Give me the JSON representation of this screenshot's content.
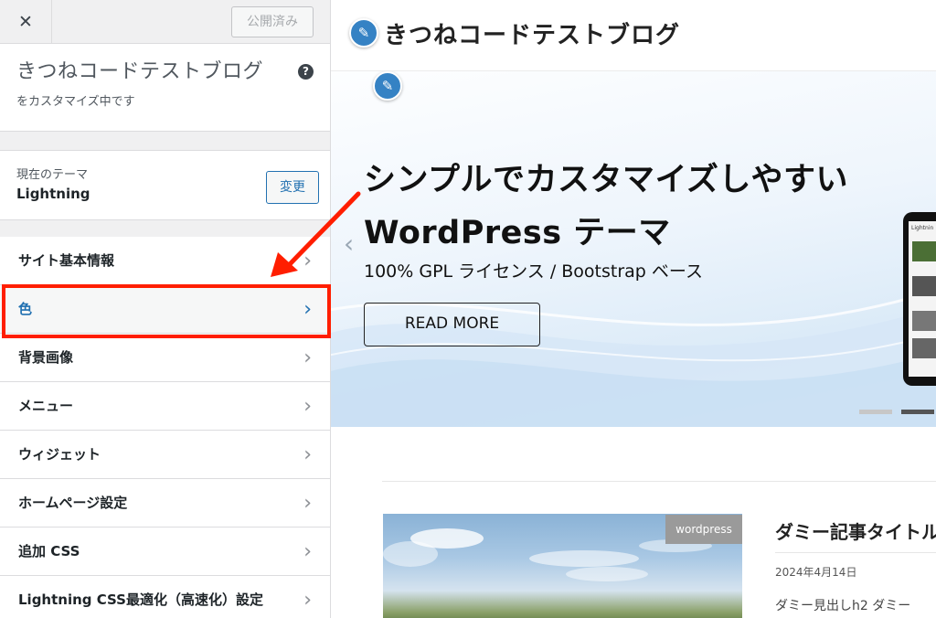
{
  "sidebar": {
    "close_glyph": "✕",
    "publish_label": "公開済み",
    "site_title": "きつねコードテストブログ",
    "site_subtitle": "をカスタマイズ中です",
    "help_glyph": "?",
    "theme_label": "現在のテーマ",
    "theme_name": "Lightning",
    "change_label": "変更",
    "items": [
      {
        "label": "サイト基本情報"
      },
      {
        "label": "色"
      },
      {
        "label": "背景画像"
      },
      {
        "label": "メニュー"
      },
      {
        "label": "ウィジェット"
      },
      {
        "label": "ホームページ設定"
      },
      {
        "label": "追加 CSS"
      },
      {
        "label": "Lightning CSS最適化（高速化）設定"
      }
    ],
    "chevron_glyph": "›",
    "active_index": 1
  },
  "annotation": {
    "color": "#ff1e00"
  },
  "preview": {
    "site_title": "きつねコードテストブログ",
    "edit_glyph": "✎",
    "hero_line1": "シンプルでカスタマイズしやすい",
    "hero_line2": "WordPress テーマ",
    "hero_sub": "100% GPL ライセンス / Bootstrap ベース",
    "read_more": "READ MORE",
    "device_label": "Lightnin",
    "post": {
      "tag": "wordpress",
      "title": "ダミー記事タイトル",
      "date": "2024年4月14日",
      "excerpt": "ダミー見出しh2 ダミー"
    }
  },
  "colors": {
    "accent": "#2271b1",
    "edit_badge": "#3582c4",
    "highlight": "#ff1e00"
  }
}
